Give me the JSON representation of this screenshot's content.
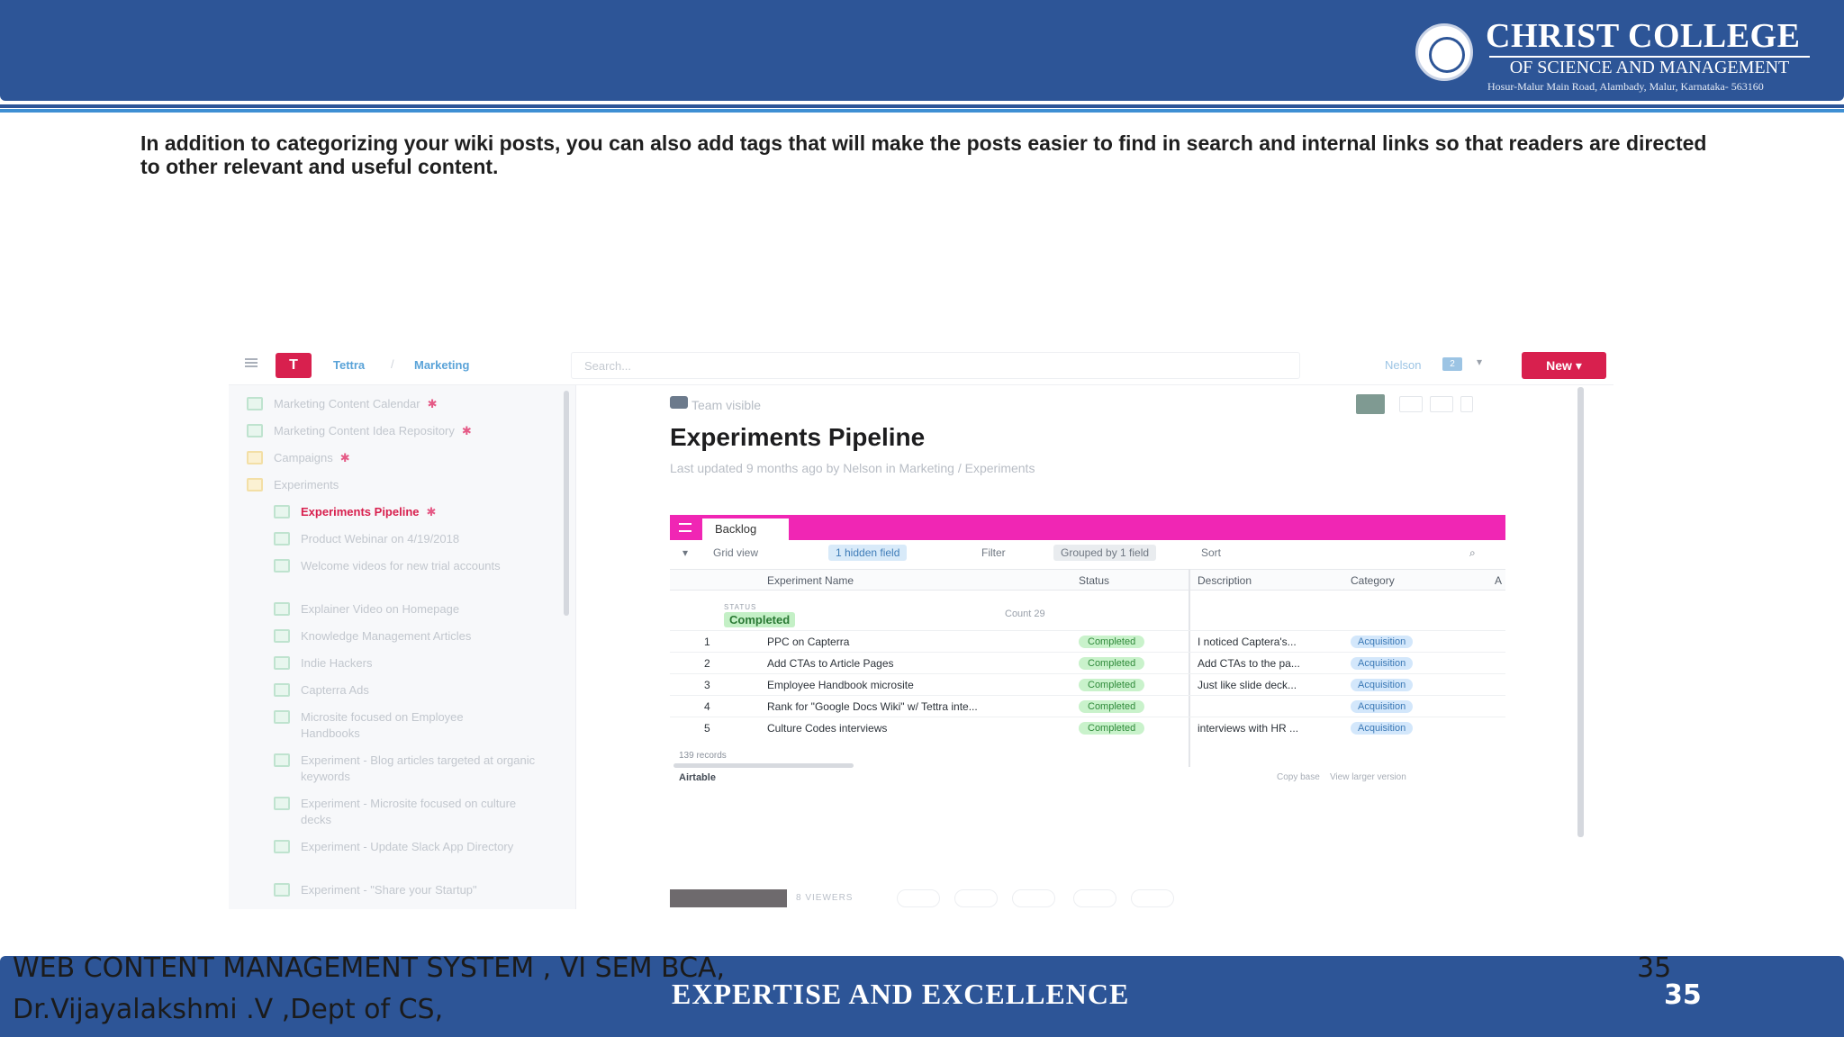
{
  "header": {
    "college_name": "CHRIST COLLEGE",
    "college_sub": "OF SCIENCE AND MANAGEMENT",
    "address": "Hosur-Malur Main Road, Alambady, Malur, Karnataka- 563160"
  },
  "intro": "In addition to categorizing your wiki posts, you can also add tags that will make the posts easier to find in search and internal links so that readers are directed to other relevant and useful content.",
  "screenshot": {
    "breadcrumb": [
      "Tettra",
      "Marketing"
    ],
    "search_placeholder": "Search...",
    "user_name": "Nelson",
    "user_count": "2",
    "new_button": "New",
    "sidebar_items": [
      {
        "label": "Marketing Content Calendar",
        "type": "page",
        "pinned": true
      },
      {
        "label": "Marketing Content Idea Repository",
        "type": "page",
        "pinned": true
      },
      {
        "label": "Campaigns",
        "type": "folder",
        "pinned": true
      },
      {
        "label": "Experiments",
        "type": "folder",
        "pinned": false
      },
      {
        "label": "Experiments Pipeline",
        "type": "page",
        "pinned": true,
        "active": true
      },
      {
        "label": "Product Webinar on 4/19/2018",
        "type": "page"
      },
      {
        "label": "Welcome videos for new trial accounts",
        "type": "page"
      },
      {
        "label": "Explainer Video on Homepage",
        "type": "page"
      },
      {
        "label": "Knowledge Management Articles",
        "type": "page"
      },
      {
        "label": "Indie Hackers",
        "type": "page"
      },
      {
        "label": "Capterra Ads",
        "type": "page"
      },
      {
        "label": "Microsite focused on Employee Handbooks",
        "type": "page"
      },
      {
        "label": "Experiment - Blog articles targeted at organic keywords",
        "type": "page"
      },
      {
        "label": "Experiment - Microsite focused on culture decks",
        "type": "page"
      },
      {
        "label": "Experiment - Update Slack App Directory",
        "type": "page"
      },
      {
        "label": "Experiment - \"Share your Startup\"",
        "type": "page"
      }
    ],
    "visibility": "Team visible",
    "doc_title": "Experiments Pipeline",
    "doc_meta": "Last updated 9 months ago by Nelson in Marketing / Experiments",
    "airtable": {
      "tab": "Backlog",
      "toolbar": [
        "Grid view",
        "1 hidden field",
        "Filter",
        "Grouped by 1 field",
        "Sort"
      ],
      "columns": [
        "Experiment Name",
        "Status",
        "Description",
        "Category",
        "A"
      ],
      "group_label": "STATUS",
      "group_value": "Completed",
      "group_count": "Count 29",
      "rows": [
        {
          "n": "1",
          "name": "PPC on Capterra",
          "status": "Completed",
          "desc": "I noticed Captera's...",
          "cat": "Acquisition"
        },
        {
          "n": "2",
          "name": "Add CTAs to Article Pages",
          "status": "Completed",
          "desc": "Add CTAs to the pa...",
          "cat": "Acquisition"
        },
        {
          "n": "3",
          "name": "Employee Handbook microsite",
          "status": "Completed",
          "desc": "Just like slide deck...",
          "cat": "Acquisition"
        },
        {
          "n": "4",
          "name": "Rank for \"Google Docs Wiki\" w/ Tettra inte...",
          "status": "Completed",
          "desc": "",
          "cat": "Acquisition"
        },
        {
          "n": "5",
          "name": "Culture Codes interviews",
          "status": "Completed",
          "desc": "interviews with HR ...",
          "cat": "Acquisition"
        }
      ],
      "records": "139 records",
      "brand": "Airtable",
      "copy_base": "Copy base",
      "view_larger": "View larger version"
    },
    "viewers": "8 VIEWERS"
  },
  "footer": {
    "course": "WEB CONTENT MANAGEMENT SYSTEM , VI SEM BCA,",
    "author": "Dr.Vijayalakshmi .V ,Dept of CS,",
    "tagline": "EXPERTISE AND EXCELLENCE",
    "page_a": "35",
    "page_b": "35"
  },
  "colors": {
    "header_blue": "#2d5597",
    "accent_line": "#3e8fd3",
    "tettra_red": "#d8204e",
    "airtable_pink": "#f026b4"
  }
}
